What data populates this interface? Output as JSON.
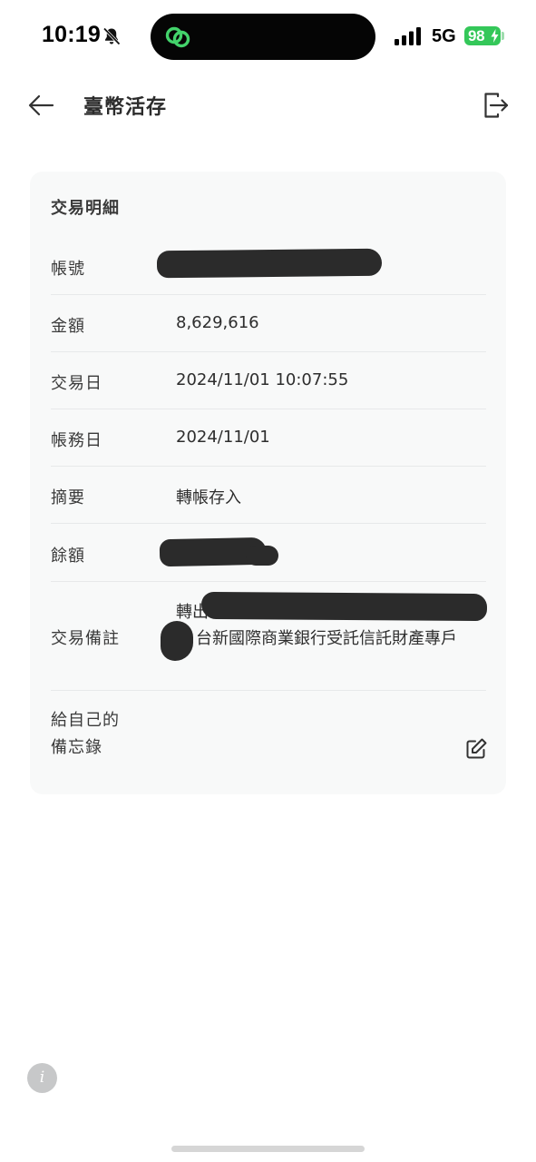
{
  "status_bar": {
    "time": "10:19",
    "network": "5G",
    "battery": "98",
    "battery_color": "#34c759",
    "icons": [
      "bell-slash-icon",
      "link-circles-icon",
      "signal-bars-icon",
      "battery-icon"
    ]
  },
  "header": {
    "title": "臺幣活存",
    "back_icon": "arrow-left-icon",
    "logout_icon": "logout-icon"
  },
  "card": {
    "title": "交易明細",
    "rows": [
      {
        "label": "帳號",
        "value": ""
      },
      {
        "label": "金額",
        "value": "8,629,616"
      },
      {
        "label": "交易日",
        "value": "2024/11/01 10:07:55"
      },
      {
        "label": "帳務日",
        "value": "2024/11/01"
      },
      {
        "label": "摘要",
        "value": "轉帳存入"
      },
      {
        "label": "餘額",
        "value": ""
      },
      {
        "label": "交易備註",
        "value_line1": "轉出",
        "value_line2": "台新國際商業銀行受託信託財產專戶"
      }
    ],
    "memo": {
      "label_line1": "給自己的",
      "label_line2": "備忘錄",
      "edit_icon": "edit-icon"
    }
  },
  "footer": {
    "info_icon": "info-icon",
    "info_glyph": "i"
  },
  "colors": {
    "background": "#ffffff",
    "card_background": "#f8f9f9",
    "divider": "#e7e9ea",
    "redaction": "#2b2b2b",
    "text": "#2e2e2e"
  }
}
